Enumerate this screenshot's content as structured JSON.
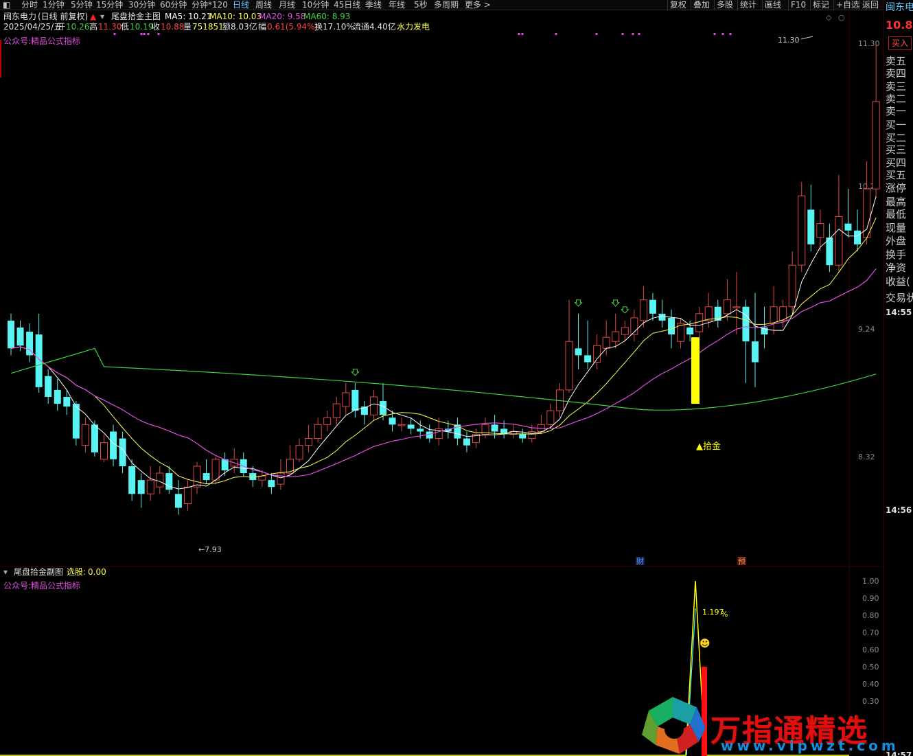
{
  "toolbar": {
    "items": [
      "分时",
      "1分钟",
      "5分钟",
      "15分钟",
      "30分钟",
      "60分钟",
      "分钟*120",
      "日线",
      "周线",
      "月线",
      "10分钟",
      "45日线",
      "季线",
      "年线",
      "5秒",
      "多周期",
      "更多 >"
    ],
    "active": "日线",
    "right_items": [
      "复权",
      "叠加",
      "多股",
      "统计",
      "画线",
      "F10",
      "标记",
      "+自选",
      "返回"
    ]
  },
  "header": {
    "stock": "闽东电力",
    "mode": "(日线 前复权)",
    "indicator": "尾盘拾金主图",
    "ma5": "MA5: 10.21",
    "ma10": "MA10: 10.03",
    "ma20": "MA20: 9.58",
    "ma60": "MA60: 8.93",
    "date": "2025/04/25/五",
    "open_label": "开",
    "open": "10.26",
    "high_label": "高",
    "high": "11.30",
    "low_label": "低",
    "low": "10.19",
    "close_label": "收",
    "close": "10.88",
    "vol_label": "量",
    "vol": "751851",
    "amt": "额8.03亿",
    "chg_label": "幅",
    "chg": "0.61(5.94%)",
    "turnover": "换17.10%",
    "float": "流通4.40亿",
    "concept": "水力发电",
    "promo": "公众号:精品公式指标"
  },
  "colors": {
    "up": "#e04848",
    "down": "#58f4f4",
    "ma5": "#ffffff",
    "ma10": "#ffff50",
    "ma20": "#e050e0",
    "ma60": "#40d040",
    "signal": "#ffff00",
    "grid": "#3a0000"
  },
  "chart_data": {
    "type": "candlestick",
    "y_ticks": [
      "11.30",
      "10.27",
      "9.24",
      "8.32"
    ],
    "ylim": [
      7.7,
      11.35
    ],
    "labels": {
      "max": "11.30",
      "min": "7.93",
      "signal": "▲拾金",
      "cai": "财",
      "yu": "预"
    },
    "candles": [
      [
        9.3,
        9.1,
        9.35,
        9.05
      ],
      [
        9.25,
        9.12,
        9.3,
        9.08
      ],
      [
        9.22,
        9.05,
        9.28,
        9.0
      ],
      [
        9.2,
        8.82,
        9.35,
        8.78
      ],
      [
        8.9,
        8.75,
        8.95,
        8.7
      ],
      [
        8.8,
        8.7,
        8.88,
        8.65
      ],
      [
        8.75,
        8.68,
        8.8,
        8.62
      ],
      [
        8.7,
        8.45,
        8.72,
        8.4
      ],
      [
        8.4,
        8.55,
        8.6,
        8.35
      ],
      [
        8.55,
        8.35,
        8.58,
        8.32
      ],
      [
        8.3,
        8.42,
        8.48,
        8.28
      ],
      [
        8.5,
        8.3,
        8.55,
        8.25
      ],
      [
        8.45,
        8.25,
        8.5,
        8.2
      ],
      [
        8.25,
        8.05,
        8.3,
        8.0
      ],
      [
        8.15,
        8.05,
        8.2,
        7.95
      ],
      [
        8.05,
        8.15,
        8.25,
        8.0
      ],
      [
        8.1,
        8.2,
        8.25,
        8.05
      ],
      [
        8.2,
        8.08,
        8.25,
        8.05
      ],
      [
        8.05,
        7.95,
        8.15,
        7.9
      ],
      [
        7.98,
        8.1,
        8.15,
        7.93
      ],
      [
        8.1,
        8.25,
        8.28,
        8.05
      ],
      [
        8.2,
        8.15,
        8.3,
        8.12
      ],
      [
        8.15,
        8.3,
        8.32,
        8.12
      ],
      [
        8.3,
        8.22,
        8.35,
        8.18
      ],
      [
        8.25,
        8.3,
        8.38,
        8.2
      ],
      [
        8.3,
        8.2,
        8.35,
        8.18
      ],
      [
        8.2,
        8.15,
        8.25,
        8.1
      ],
      [
        8.15,
        8.18,
        8.22,
        8.1
      ],
      [
        8.15,
        8.1,
        8.2,
        8.05
      ],
      [
        8.12,
        8.2,
        8.3,
        8.08
      ],
      [
        8.2,
        8.3,
        8.4,
        8.18
      ],
      [
        8.3,
        8.4,
        8.45,
        8.28
      ],
      [
        8.4,
        8.45,
        8.55,
        8.35
      ],
      [
        8.45,
        8.55,
        8.6,
        8.42
      ],
      [
        8.55,
        8.6,
        8.65,
        8.5
      ],
      [
        8.6,
        8.7,
        8.75,
        8.55
      ],
      [
        8.68,
        8.78,
        8.85,
        8.62
      ],
      [
        8.8,
        8.65,
        8.85,
        8.6
      ],
      [
        8.68,
        8.62,
        8.72,
        8.55
      ],
      [
        8.62,
        8.75,
        8.8,
        8.58
      ],
      [
        8.72,
        8.62,
        8.85,
        8.58
      ],
      [
        8.6,
        8.55,
        8.65,
        8.5
      ],
      [
        8.55,
        8.55,
        8.6,
        8.5
      ],
      [
        8.55,
        8.52,
        8.6,
        8.48
      ],
      [
        8.52,
        8.5,
        8.58,
        8.45
      ],
      [
        8.5,
        8.45,
        8.55,
        8.42
      ],
      [
        8.45,
        8.52,
        8.6,
        8.4
      ],
      [
        8.52,
        8.5,
        8.58,
        8.45
      ],
      [
        8.55,
        8.45,
        8.6,
        8.4
      ],
      [
        8.45,
        8.4,
        8.5,
        8.35
      ],
      [
        8.42,
        8.48,
        8.52,
        8.38
      ],
      [
        8.48,
        8.55,
        8.6,
        8.45
      ],
      [
        8.55,
        8.5,
        8.62,
        8.45
      ],
      [
        8.52,
        8.48,
        8.58,
        8.45
      ],
      [
        8.48,
        8.5,
        8.55,
        8.45
      ],
      [
        8.48,
        8.45,
        8.52,
        8.42
      ],
      [
        8.45,
        8.5,
        8.55,
        8.42
      ],
      [
        8.5,
        8.55,
        8.62,
        8.48
      ],
      [
        8.55,
        8.65,
        8.7,
        8.52
      ],
      [
        8.65,
        8.8,
        8.85,
        8.6
      ],
      [
        8.8,
        9.15,
        9.45,
        8.78
      ],
      [
        9.1,
        9.05,
        9.35,
        8.95
      ],
      [
        9.05,
        9.0,
        9.3,
        8.95
      ],
      [
        9.0,
        9.12,
        9.2,
        8.95
      ],
      [
        9.1,
        9.18,
        9.3,
        9.05
      ],
      [
        9.15,
        9.22,
        9.35,
        9.1
      ],
      [
        9.2,
        9.25,
        9.3,
        9.15
      ],
      [
        9.2,
        9.32,
        9.38,
        9.15
      ],
      [
        9.3,
        9.45,
        9.55,
        9.25
      ],
      [
        9.45,
        9.35,
        9.5,
        9.3
      ],
      [
        9.35,
        9.3,
        9.45,
        9.25
      ],
      [
        9.32,
        9.2,
        9.38,
        9.1
      ],
      [
        9.15,
        9.28,
        9.32,
        9.1
      ],
      [
        9.25,
        9.2,
        9.3,
        9.15
      ],
      [
        9.22,
        9.35,
        9.4,
        9.18
      ],
      [
        9.3,
        9.4,
        9.5,
        9.25
      ],
      [
        9.4,
        9.3,
        9.45,
        9.25
      ],
      [
        9.35,
        9.45,
        9.6,
        9.3
      ],
      [
        9.4,
        9.4,
        9.65,
        9.2
      ],
      [
        9.4,
        9.15,
        9.45,
        8.85
      ],
      [
        9.15,
        9.0,
        9.5,
        8.82
      ],
      [
        9.25,
        9.2,
        9.4,
        9.1
      ],
      [
        9.28,
        9.4,
        9.55,
        9.2
      ],
      [
        9.3,
        9.4,
        9.45,
        9.25
      ],
      [
        9.4,
        9.7,
        9.8,
        9.35
      ],
      [
        9.7,
        10.2,
        10.3,
        9.65
      ],
      [
        10.1,
        9.85,
        10.28,
        9.8
      ],
      [
        9.9,
        10.0,
        10.1,
        9.8
      ],
      [
        9.9,
        9.7,
        10.0,
        9.65
      ],
      [
        9.7,
        10.05,
        10.35,
        9.65
      ],
      [
        10.0,
        9.95,
        10.25,
        9.9
      ],
      [
        9.95,
        9.85,
        10.1,
        9.8
      ],
      [
        9.9,
        10.25,
        10.45,
        9.85
      ],
      [
        10.25,
        10.88,
        11.3,
        10.19
      ]
    ],
    "ma_note": "MA5 MA10 MA20 MA60",
    "sub": {
      "title": "尾盘拾金副图",
      "xg_label": "选股:",
      "xg_value": "0.00",
      "y_ticks": [
        "1.00",
        "0.90",
        "0.80",
        "0.70",
        "0.60",
        "0.50",
        "0.40",
        "0.30"
      ],
      "annotation": "1.197",
      "percent": "%",
      "smile": "☻"
    }
  },
  "right_panel": {
    "name": "闽东电",
    "price": "10.8",
    "buy_btn": "买入",
    "levels": [
      "卖五",
      "卖四",
      "卖三",
      "卖二",
      "卖一",
      "买一",
      "买二",
      "买三",
      "买四",
      "买五",
      "涨停",
      "最高",
      "最低",
      "现量",
      "外盘",
      "换手",
      "净资",
      "收益(",
      "交易状"
    ],
    "time1": "14:55",
    "time2": "14:56",
    "time3": "14:57"
  },
  "watermark": {
    "text": "万指通精选",
    "url": "www.vipwzt.com"
  }
}
